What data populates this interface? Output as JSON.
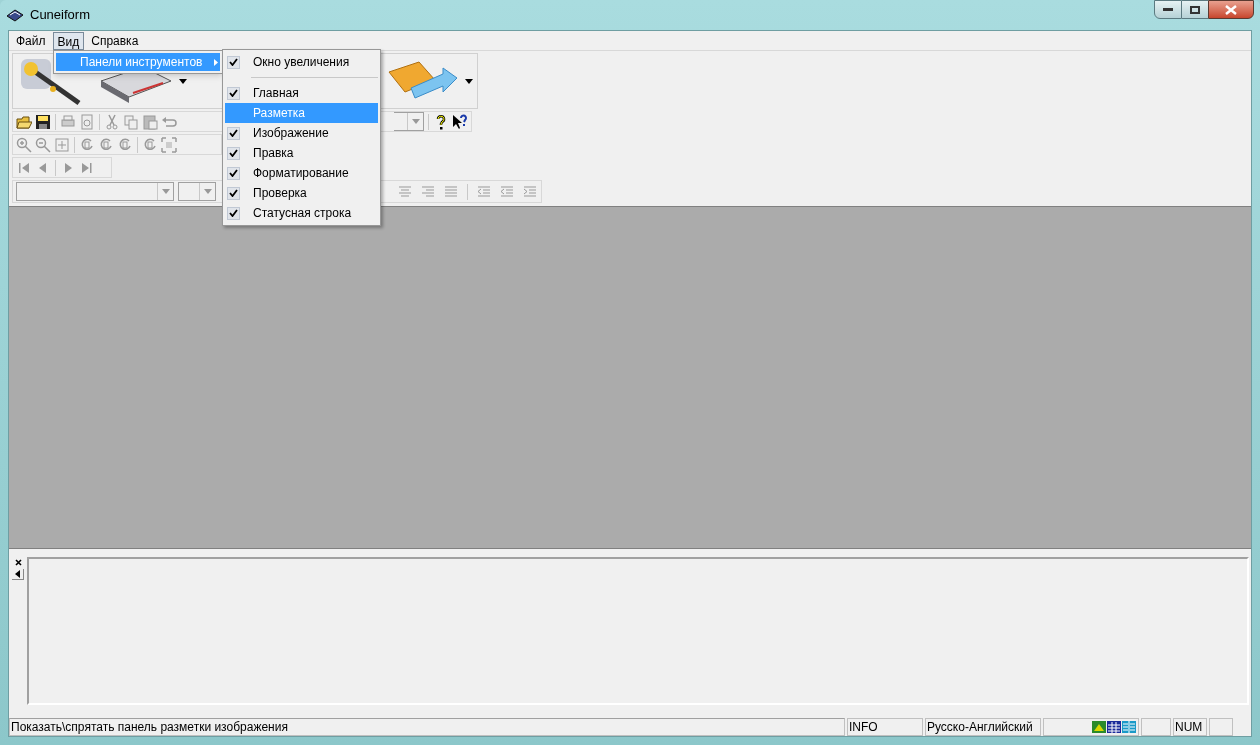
{
  "window": {
    "title": "Cuneiform"
  },
  "menu_bar": [
    {
      "label": "Файл",
      "selected": false
    },
    {
      "label": "Вид",
      "selected": true
    },
    {
      "label": "Справка",
      "selected": false
    }
  ],
  "view_menu": [
    {
      "label": "Панели инструментов",
      "selected": true,
      "has_submenu": true
    }
  ],
  "toolbars_submenu": [
    {
      "label": "Окно увеличения",
      "checked": true,
      "selected": false,
      "separator_after": true
    },
    {
      "label": "Главная",
      "checked": true,
      "selected": false,
      "separator_after": false
    },
    {
      "label": "Разметка",
      "checked": false,
      "selected": true,
      "separator_after": false
    },
    {
      "label": "Изображение",
      "checked": true,
      "selected": false,
      "separator_after": false
    },
    {
      "label": "Правка",
      "checked": true,
      "selected": false,
      "separator_after": false
    },
    {
      "label": "Форматирование",
      "checked": true,
      "selected": false,
      "separator_after": false
    },
    {
      "label": "Проверка",
      "checked": true,
      "selected": false,
      "separator_after": false
    },
    {
      "label": "Статусная строка",
      "checked": true,
      "selected": false,
      "separator_after": false
    }
  ],
  "status_bar": {
    "message": "Показать\\спрятать панель разметки изображения",
    "info": "INFO",
    "language": "Русско-Английский",
    "num": "NUM"
  }
}
